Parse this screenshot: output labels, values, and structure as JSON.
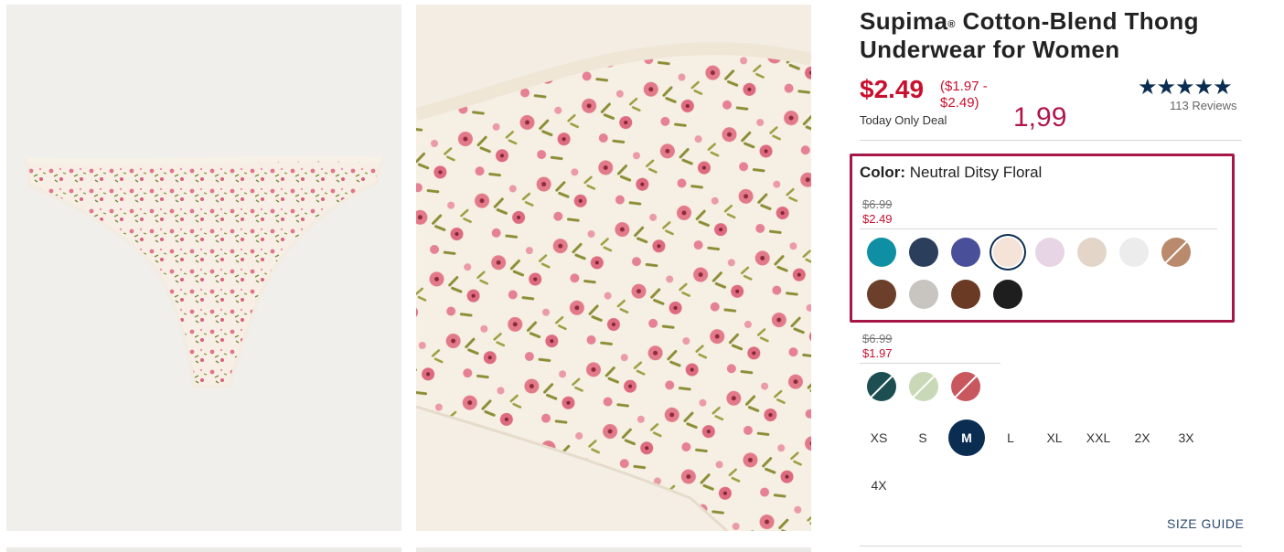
{
  "product": {
    "title_part1": "Supima",
    "title_mark": "®",
    "title_part2": " Cotton-Blend Thong Underwear for Women",
    "price": "$2.49",
    "price_range": "($1.97 - $2.49)",
    "deal_label": "Today Only Deal",
    "handwritten_note": "1,99",
    "stars": "★★★★★",
    "reviews": "113 Reviews"
  },
  "color": {
    "label": "Color:",
    "selected_name": "Neutral Ditsy Floral",
    "group1": {
      "old_price": "$6.99",
      "new_price": "$2.49",
      "swatches": [
        {
          "name": "teal",
          "color": "#0e8fa3"
        },
        {
          "name": "navy-stripe",
          "color": "#2b3e5c"
        },
        {
          "name": "multi-floral",
          "color": "#4a4f9a"
        },
        {
          "name": "neutral-ditsy-floral",
          "color": "#f4e3d6",
          "selected": true
        },
        {
          "name": "lavender",
          "color": "#e7d5e6"
        },
        {
          "name": "beige",
          "color": "#e3d6c9"
        },
        {
          "name": "light-gray",
          "color": "#ececec"
        },
        {
          "name": "tan-unavailable",
          "color": "#b98b6c",
          "unavailable": true
        },
        {
          "name": "brown",
          "color": "#6b3f2a"
        },
        {
          "name": "leopard-gray",
          "color": "#c8c4c0"
        },
        {
          "name": "chocolate",
          "color": "#6a3a24"
        },
        {
          "name": "black",
          "color": "#1e1e1e"
        }
      ]
    },
    "group2": {
      "old_price": "$6.99",
      "new_price": "$1.97",
      "swatches": [
        {
          "name": "dark-teal-unavailable",
          "color": "#1d4f52",
          "unavailable": true
        },
        {
          "name": "tropical-unavailable",
          "color": "#c9d9b8",
          "unavailable": true
        },
        {
          "name": "rose-unavailable",
          "color": "#c9575e",
          "unavailable": true
        }
      ]
    }
  },
  "sizes": [
    {
      "label": "XS"
    },
    {
      "label": "S"
    },
    {
      "label": "M",
      "selected": true
    },
    {
      "label": "L"
    },
    {
      "label": "XL"
    },
    {
      "label": "XXL"
    },
    {
      "label": "2X"
    },
    {
      "label": "3X"
    },
    {
      "label": "4X"
    }
  ],
  "size_guide": "SIZE GUIDE"
}
